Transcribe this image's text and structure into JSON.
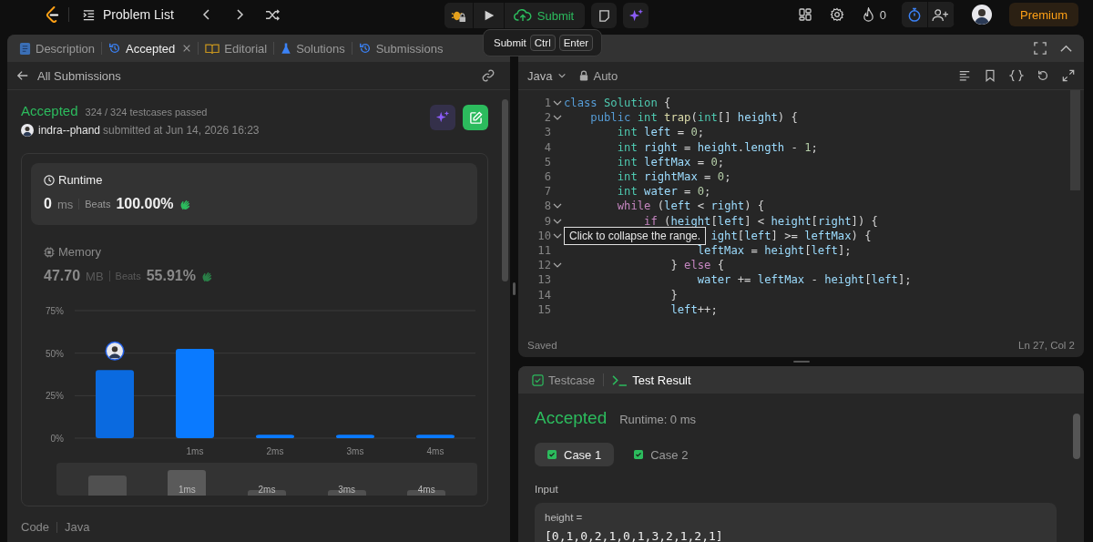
{
  "top_bar": {
    "title": "Problem List",
    "submit": "Submit",
    "streak": "0",
    "premium": "Premium"
  },
  "shortcut_tooltip": {
    "label": "Submit",
    "keys": [
      "Ctrl",
      "Enter"
    ]
  },
  "left_panel": {
    "tabs": [
      {
        "label": "Description",
        "kind": "description",
        "selected": false,
        "closable": false
      },
      {
        "label": "Accepted",
        "kind": "history",
        "selected": true,
        "closable": true
      },
      {
        "label": "Editorial",
        "kind": "book",
        "selected": false,
        "closable": false
      },
      {
        "label": "Solutions",
        "kind": "flask",
        "selected": false,
        "closable": false
      },
      {
        "label": "Submissions",
        "kind": "history",
        "selected": false,
        "closable": false
      }
    ],
    "back_link": "All Submissions",
    "submission": {
      "status": "Accepted",
      "testcases": "324 / 324 testcases passed",
      "user": "indra--phand",
      "submitted": "submitted at Jun 14, 2026 16:23"
    },
    "stats": [
      {
        "kind": "runtime",
        "title": "Runtime",
        "value": "0",
        "unit": "ms",
        "beats_label": "Beats",
        "beats": "100.00%",
        "selected": true
      },
      {
        "kind": "memory",
        "title": "Memory",
        "value": "47.70",
        "unit": "MB",
        "beats_label": "Beats",
        "beats": "55.91%",
        "selected": false
      }
    ],
    "chart_data": {
      "type": "bar",
      "x": [
        0,
        1,
        2,
        3,
        4
      ],
      "xlim": [
        -0.5,
        4.5
      ],
      "values": [
        40,
        52.5,
        2,
        2,
        2
      ],
      "ylim": [
        0,
        75
      ],
      "yticks": [
        {
          "value": 0,
          "label": "0%"
        },
        {
          "value": 25,
          "label": "25%"
        },
        {
          "value": 50,
          "label": "50%"
        },
        {
          "value": 75,
          "label": "75%"
        }
      ],
      "xticks": [
        {
          "value": 1,
          "label": "1ms"
        },
        {
          "value": 2,
          "label": "2ms"
        },
        {
          "value": 3,
          "label": "3ms"
        },
        {
          "value": 4,
          "label": "4ms"
        }
      ]
    },
    "overview_labels": [
      "1ms",
      "2ms",
      "3ms",
      "4ms"
    ],
    "code_label": "Code",
    "code_language": "Java"
  },
  "editor": {
    "language": "Java",
    "mode": "Auto",
    "tooltip": "Click to collapse the range.",
    "status": "Saved",
    "cursor": "Ln 27, Col 2",
    "lines": [
      {
        "number": "1",
        "fold": true,
        "tokens": [
          {
            "kind": "mod",
            "text": "class "
          },
          {
            "kind": "type",
            "text": "Solution"
          },
          {
            "kind": "op",
            "text": " {"
          }
        ]
      },
      {
        "number": "2",
        "fold": true,
        "tokens": [
          {
            "kind": "mod",
            "text": "    public "
          },
          {
            "kind": "type",
            "text": "int "
          },
          {
            "kind": "fn",
            "text": "trap"
          },
          {
            "kind": "op",
            "text": "("
          },
          {
            "kind": "type",
            "text": "int"
          },
          {
            "kind": "op",
            "text": "[] "
          },
          {
            "kind": "var",
            "text": "height"
          },
          {
            "kind": "op",
            "text": ") {"
          }
        ]
      },
      {
        "number": "3",
        "fold": false,
        "tokens": [
          {
            "kind": "type",
            "text": "        int "
          },
          {
            "kind": "var",
            "text": "left"
          },
          {
            "kind": "op",
            "text": " = "
          },
          {
            "kind": "num",
            "text": "0"
          },
          {
            "kind": "op",
            "text": ";"
          }
        ]
      },
      {
        "number": "4",
        "fold": false,
        "tokens": [
          {
            "kind": "type",
            "text": "        int "
          },
          {
            "kind": "var",
            "text": "right"
          },
          {
            "kind": "op",
            "text": " = "
          },
          {
            "kind": "var",
            "text": "height"
          },
          {
            "kind": "op",
            "text": "."
          },
          {
            "kind": "var",
            "text": "length"
          },
          {
            "kind": "op",
            "text": " - "
          },
          {
            "kind": "num",
            "text": "1"
          },
          {
            "kind": "op",
            "text": ";"
          }
        ]
      },
      {
        "number": "5",
        "fold": false,
        "tokens": [
          {
            "kind": "type",
            "text": "        int "
          },
          {
            "kind": "var",
            "text": "leftMax"
          },
          {
            "kind": "op",
            "text": " = "
          },
          {
            "kind": "num",
            "text": "0"
          },
          {
            "kind": "op",
            "text": ";"
          }
        ]
      },
      {
        "number": "6",
        "fold": false,
        "tokens": [
          {
            "kind": "type",
            "text": "        int "
          },
          {
            "kind": "var",
            "text": "rightMax"
          },
          {
            "kind": "op",
            "text": " = "
          },
          {
            "kind": "num",
            "text": "0"
          },
          {
            "kind": "op",
            "text": ";"
          }
        ]
      },
      {
        "number": "7",
        "fold": false,
        "tokens": [
          {
            "kind": "type",
            "text": "        int "
          },
          {
            "kind": "var",
            "text": "water"
          },
          {
            "kind": "op",
            "text": " = "
          },
          {
            "kind": "num",
            "text": "0"
          },
          {
            "kind": "op",
            "text": ";"
          }
        ]
      },
      {
        "number": "8",
        "fold": true,
        "tokens": [
          {
            "kind": "kw",
            "text": "        while"
          },
          {
            "kind": "op",
            "text": " ("
          },
          {
            "kind": "var",
            "text": "left"
          },
          {
            "kind": "op",
            "text": " < "
          },
          {
            "kind": "var",
            "text": "right"
          },
          {
            "kind": "op",
            "text": ") {"
          }
        ]
      },
      {
        "number": "9",
        "fold": true,
        "tokens": [
          {
            "kind": "kw",
            "text": "            if"
          },
          {
            "kind": "op",
            "text": " ("
          },
          {
            "kind": "var",
            "text": "height"
          },
          {
            "kind": "op",
            "text": "["
          },
          {
            "kind": "var",
            "text": "left"
          },
          {
            "kind": "op",
            "text": "] < "
          },
          {
            "kind": "var",
            "text": "height"
          },
          {
            "kind": "op",
            "text": "["
          },
          {
            "kind": "var",
            "text": "right"
          },
          {
            "kind": "op",
            "text": "]) {"
          }
        ]
      },
      {
        "number": "10",
        "fold": true,
        "tokens": [
          {
            "kind": "var",
            "text": "                      ight"
          },
          {
            "kind": "op",
            "text": "["
          },
          {
            "kind": "var",
            "text": "left"
          },
          {
            "kind": "op",
            "text": "] >= "
          },
          {
            "kind": "var",
            "text": "leftMax"
          },
          {
            "kind": "op",
            "text": ") {"
          }
        ]
      },
      {
        "number": "11",
        "fold": false,
        "tokens": [
          {
            "kind": "var",
            "text": "                    leftMax"
          },
          {
            "kind": "op",
            "text": " = "
          },
          {
            "kind": "var",
            "text": "height"
          },
          {
            "kind": "op",
            "text": "["
          },
          {
            "kind": "var",
            "text": "left"
          },
          {
            "kind": "op",
            "text": "];"
          }
        ]
      },
      {
        "number": "12",
        "fold": true,
        "tokens": [
          {
            "kind": "op",
            "text": "                } "
          },
          {
            "kind": "kw",
            "text": "else"
          },
          {
            "kind": "op",
            "text": " {"
          }
        ]
      },
      {
        "number": "13",
        "fold": false,
        "tokens": [
          {
            "kind": "var",
            "text": "                    water"
          },
          {
            "kind": "op",
            "text": " += "
          },
          {
            "kind": "var",
            "text": "leftMax"
          },
          {
            "kind": "op",
            "text": " - "
          },
          {
            "kind": "var",
            "text": "height"
          },
          {
            "kind": "op",
            "text": "["
          },
          {
            "kind": "var",
            "text": "left"
          },
          {
            "kind": "op",
            "text": "];"
          }
        ]
      },
      {
        "number": "14",
        "fold": false,
        "tokens": [
          {
            "kind": "op",
            "text": "                }"
          }
        ]
      },
      {
        "number": "15",
        "fold": false,
        "tokens": [
          {
            "kind": "var",
            "text": "                left"
          },
          {
            "kind": "op",
            "text": "++;"
          }
        ]
      }
    ]
  },
  "result_panel": {
    "tabs": [
      {
        "label": "Testcase",
        "kind": "check",
        "selected": false
      },
      {
        "label": "Test Result",
        "kind": "terminal",
        "selected": true
      }
    ],
    "status": "Accepted",
    "runtime": "Runtime: 0 ms",
    "cases": [
      {
        "label": "Case 1",
        "selected": true,
        "passed": true
      },
      {
        "label": "Case 2",
        "selected": false,
        "passed": true
      }
    ],
    "input_label": "Input",
    "param": "height =",
    "value": "[0,1,0,2,1,0,1,3,2,1,2,1]"
  }
}
